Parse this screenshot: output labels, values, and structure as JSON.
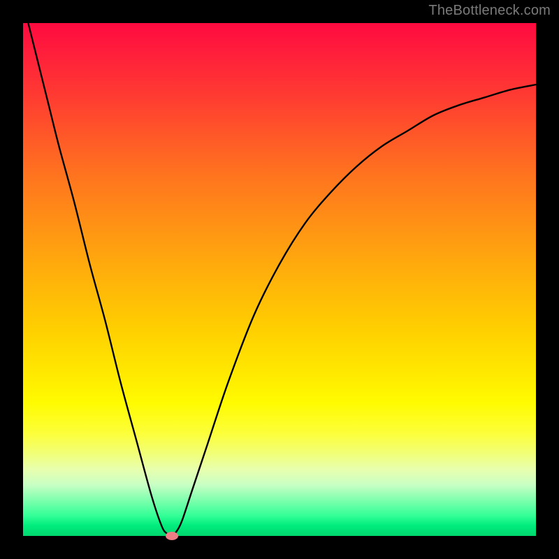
{
  "attribution": "TheBottleneck.com",
  "chart_data": {
    "type": "line",
    "title": "",
    "xlabel": "",
    "ylabel": "",
    "xlim": [
      0,
      100
    ],
    "ylim": [
      0,
      100
    ],
    "grid": false,
    "legend": false,
    "series": [
      {
        "name": "bottleneck-curve",
        "color": "#000000",
        "x": [
          1,
          3,
          5,
          7,
          10,
          13,
          16,
          19,
          22,
          25,
          27,
          28,
          29,
          30,
          31,
          33,
          36,
          40,
          45,
          50,
          55,
          60,
          65,
          70,
          75,
          80,
          85,
          90,
          95,
          100
        ],
        "values": [
          100,
          92,
          84,
          76,
          65,
          53,
          42,
          30,
          19,
          8,
          2,
          0.5,
          0,
          1,
          3,
          9,
          18,
          30,
          43,
          53,
          61,
          67,
          72,
          76,
          79,
          82,
          84,
          85.5,
          87,
          88
        ]
      }
    ],
    "marker": {
      "x": 29,
      "y": 0,
      "color": "#ee7d86"
    },
    "background_gradient": {
      "top": "#ff0a40",
      "mid": "#ffd000",
      "bottom": "#00d76e"
    }
  }
}
